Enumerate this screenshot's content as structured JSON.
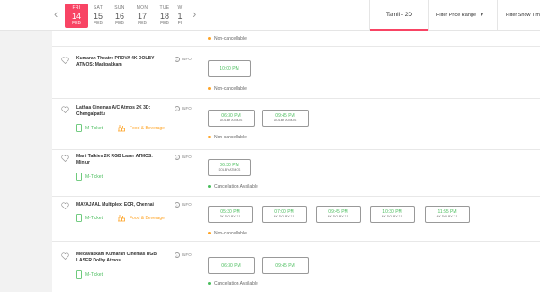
{
  "date_strip": {
    "prev_arrow": "‹",
    "next_arrow": "›",
    "dates": [
      {
        "dow": "FRI",
        "day": "14",
        "mon": "FEB",
        "active": true
      },
      {
        "dow": "SAT",
        "day": "15",
        "mon": "FEB"
      },
      {
        "dow": "SUN",
        "day": "16",
        "mon": "FEB"
      },
      {
        "dow": "MON",
        "day": "17",
        "mon": "FEB"
      },
      {
        "dow": "TUE",
        "day": "18",
        "mon": "FEB"
      },
      {
        "dow": "W",
        "day": "1",
        "mon": "FI"
      }
    ]
  },
  "language_tab": "Tamil - 2D",
  "filters": {
    "price": "Filter Price Range",
    "show_time": "Filter Show Tim"
  },
  "colors": {
    "accent": "#f84464",
    "available": "#4abd5d",
    "warning": "#ffa426"
  },
  "labels": {
    "info": "INFO",
    "m_ticket": "M-Ticket",
    "food": "Food & Beverage"
  },
  "theatres": [
    {
      "policy": "Non-cancellable"
    },
    {
      "name": "Kumaran Theatre PROVA 4K DOLBY ATMOS: Madipakkam",
      "showtimes": [
        {
          "time": "10:00 PM"
        }
      ],
      "policy": "Non-cancellable"
    },
    {
      "name": "Lathaa Cinemas A/C Atmos 2K 3D: Chengalpattu",
      "showtimes": [
        {
          "time": "06:30 PM",
          "sub": "DOLBY ATMOS"
        },
        {
          "time": "09:45 PM",
          "sub": "DOLBY ATMOS"
        }
      ],
      "policy": "Non-cancellable"
    },
    {
      "name": "Mani Talkies 2K RGB Laser ATMOS: Minjur",
      "showtimes": [
        {
          "time": "06:30 PM",
          "sub": "DOLBY ATMOS"
        }
      ],
      "policy": "Cancellation Available"
    },
    {
      "name": "MAYAJAAL Multiplex: ECR, Chennai",
      "showtimes": [
        {
          "time": "05:30 PM",
          "sub": "2K DOLBY 7.1"
        },
        {
          "time": "07:00 PM",
          "sub": "4K DOLBY 7.1"
        },
        {
          "time": "09:45 PM",
          "sub": "4K DOLBY 7.1"
        },
        {
          "time": "10:30 PM",
          "sub": "4K DOLBY 7.1"
        },
        {
          "time": "11:55 PM",
          "sub": "4K DOLBY 7.1"
        }
      ],
      "policy": "Non-cancellable"
    },
    {
      "name": "Medavakkam Kumaran Cinemas RGB LASER Dolby Atmos",
      "showtimes": [
        {
          "time": "06:30 PM"
        },
        {
          "time": "09:45 PM"
        }
      ],
      "policy": "Cancellation Available"
    }
  ]
}
